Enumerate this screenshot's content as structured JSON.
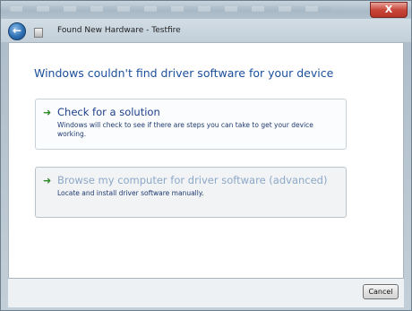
{
  "titlebar": {
    "close_label": "X"
  },
  "nav": {
    "title": "Found New Hardware - Testfire"
  },
  "content": {
    "heading": "Windows couldn't find driver software for your device",
    "options": [
      {
        "title": "Check for a solution",
        "description": "Windows will check to see if there are steps you can take to get your device working.",
        "enabled": true
      },
      {
        "title": "Browse my computer for driver software (advanced)",
        "description": "Locate and install driver software manually.",
        "enabled": false
      }
    ]
  },
  "footer": {
    "cancel_label": "Cancel"
  },
  "icons": {
    "back": "back-arrow-icon",
    "app": "hardware-icon",
    "option_arrow": "green-arrow-icon"
  },
  "colors": {
    "heading": "#1b4f9c",
    "option_title": "#1d3f8a",
    "option_disabled_title": "#8da8c8",
    "arrow": "#2e8a2b",
    "close": "#c9473a"
  }
}
